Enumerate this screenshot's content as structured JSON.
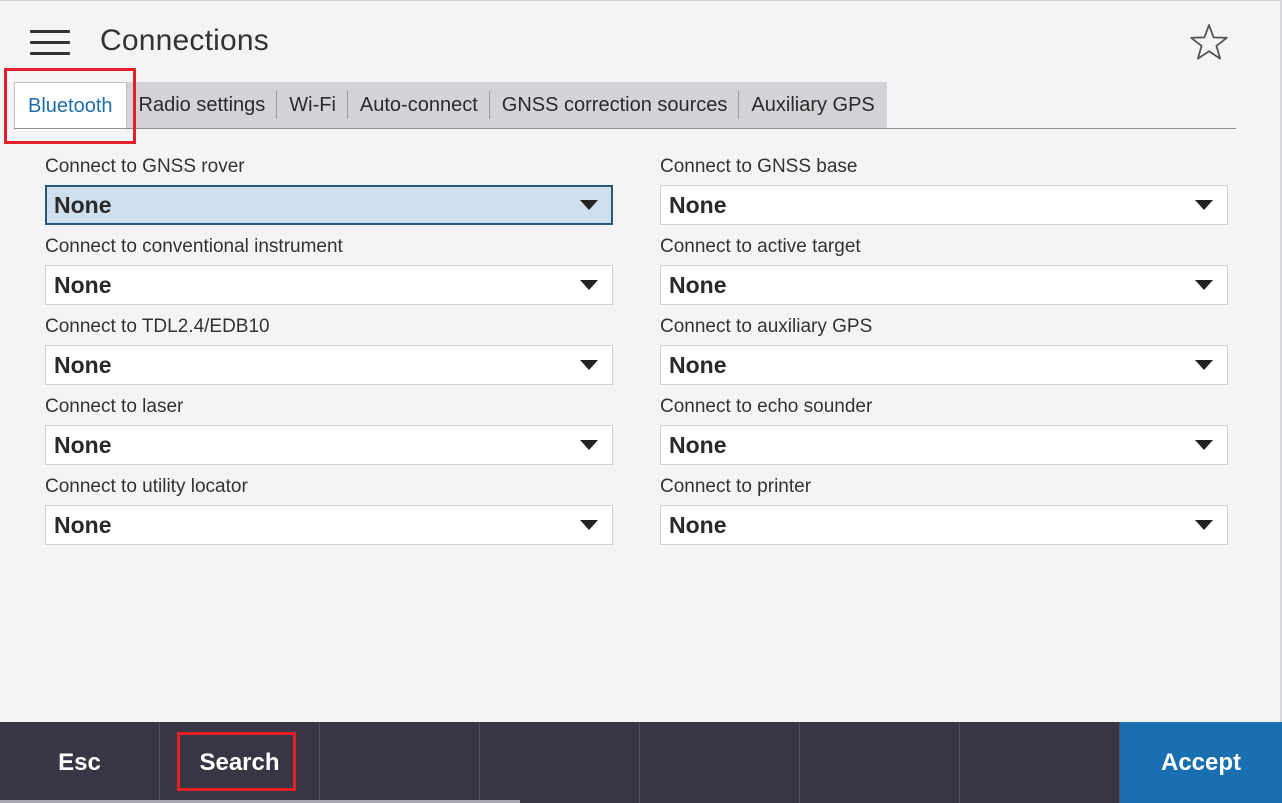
{
  "header": {
    "title": "Connections",
    "menu_icon": "hamburger-menu-icon",
    "favorite_icon": "star-outline-icon"
  },
  "tabs": [
    {
      "label": "Bluetooth",
      "active": true
    },
    {
      "label": "Radio settings",
      "active": false
    },
    {
      "label": "Wi-Fi",
      "active": false
    },
    {
      "label": "Auto-connect",
      "active": false
    },
    {
      "label": "GNSS correction sources",
      "active": false
    },
    {
      "label": "Auxiliary GPS",
      "active": false
    }
  ],
  "fields": {
    "gnss_rover": {
      "label": "Connect to GNSS rover",
      "value": "None"
    },
    "gnss_base": {
      "label": "Connect to GNSS base",
      "value": "None"
    },
    "conventional_instrument": {
      "label": "Connect to conventional instrument",
      "value": "None"
    },
    "active_target": {
      "label": "Connect to active target",
      "value": "None"
    },
    "tdl": {
      "label": "Connect to TDL2.4/EDB10",
      "value": "None"
    },
    "auxiliary_gps": {
      "label": "Connect to auxiliary GPS",
      "value": "None"
    },
    "laser": {
      "label": "Connect to laser",
      "value": "None"
    },
    "echo_sounder": {
      "label": "Connect to echo sounder",
      "value": "None"
    },
    "utility_locator": {
      "label": "Connect to utility locator",
      "value": "None"
    },
    "printer": {
      "label": "Connect to printer",
      "value": "None"
    }
  },
  "footer": {
    "esc_label": "Esc",
    "search_label": "Search",
    "accept_label": "Accept"
  },
  "colors": {
    "accent": "#1a6fb0",
    "annotation": "#e02228",
    "footer_bg": "#363645",
    "focused_field": "#cfe0ec"
  }
}
